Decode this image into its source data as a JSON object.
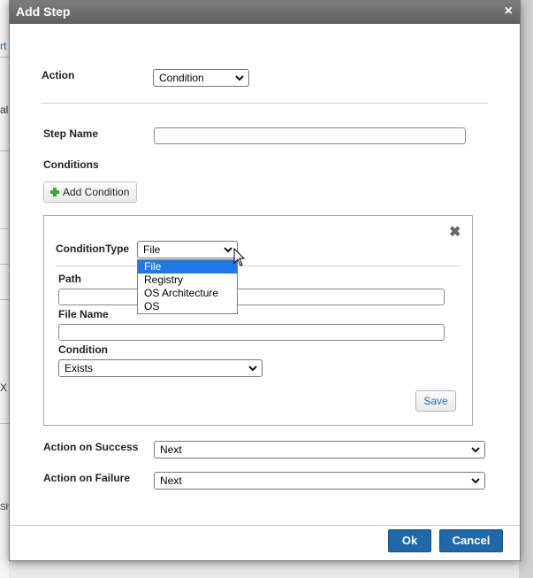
{
  "dialog": {
    "title": "Add Step",
    "close_glyph": "×"
  },
  "form": {
    "action_label": "Action",
    "action_value": "Condition",
    "step_name_label": "Step Name",
    "step_name_value": "",
    "conditions_label": "Conditions",
    "add_condition_label": "Add Condition",
    "success_label": "Action on Success",
    "success_value": "Next",
    "failure_label": "Action on Failure",
    "failure_value": "Next"
  },
  "condition_box": {
    "close_glyph": "✖",
    "type_label": "ConditionType",
    "type_value": "File",
    "type_options": [
      "File",
      "Registry",
      "OS Architecture",
      "OS"
    ],
    "path_label": "Path",
    "path_value": "",
    "file_name_label": "File Name",
    "file_name_value": "",
    "condition_label": "Condition",
    "condition_value": "Exists",
    "save_label": "Save"
  },
  "footer": {
    "ok_label": "Ok",
    "cancel_label": "Cancel"
  },
  "background": {
    "frag_1": "rt",
    "frag_2": "all",
    "frag_3": "X",
    "frag_4": "Sh"
  },
  "colors": {
    "primary": "#2068a8",
    "selected_option": "#1e78e6",
    "title_bar": "#6e6e6e"
  }
}
